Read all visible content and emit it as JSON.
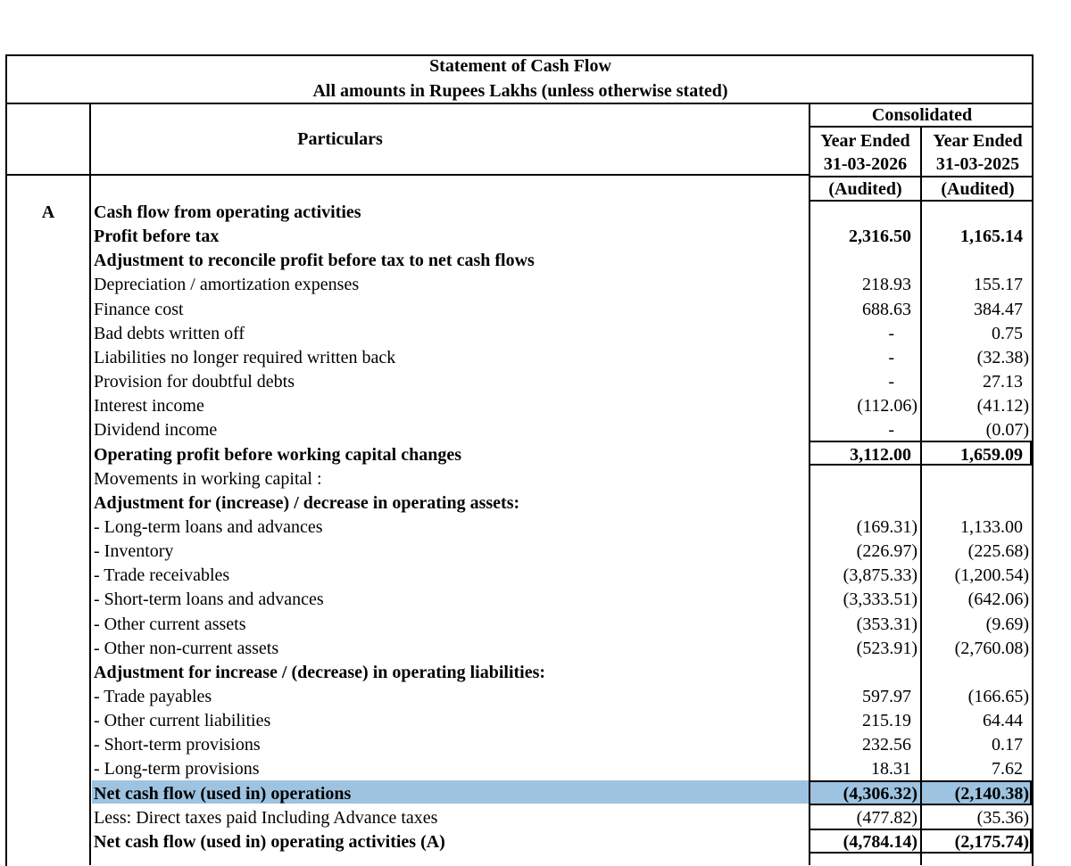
{
  "header": {
    "title": "Statement of Cash Flow",
    "subtitle": "All amounts in Rupees Lakhs (unless otherwise stated)",
    "particulars": "Particulars",
    "group": "Consolidated",
    "col1_line1": "Year Ended",
    "col1_line2": "31-03-2026",
    "col1_line3": "(Audited)",
    "col2_line1": "Year Ended",
    "col2_line2": "31-03-2025",
    "col2_line3": "(Audited)"
  },
  "section": {
    "label": "A"
  },
  "rows": [
    {
      "label": "Cash flow from operating activities",
      "v1": "",
      "v2": ""
    },
    {
      "label": "Profit before tax",
      "v1": "2,316.50",
      "v2": "1,165.14"
    },
    {
      "label": "Adjustment to reconcile profit before tax to net cash flows",
      "v1": "",
      "v2": ""
    },
    {
      "label": "Depreciation / amortization expenses",
      "v1": "218.93",
      "v2": "155.17"
    },
    {
      "label": "Finance cost",
      "v1": "688.63",
      "v2": "384.47"
    },
    {
      "label": "Bad debts written off",
      "v1": "-",
      "v2": "0.75"
    },
    {
      "label": "Liabilities no longer required written back",
      "v1": "-",
      "v2": "(32.38)"
    },
    {
      "label": "Provision for doubtful debts",
      "v1": "-",
      "v2": "27.13"
    },
    {
      "label": "Interest income",
      "v1": "(112.06)",
      "v2": "(41.12)"
    },
    {
      "label": "Dividend income",
      "v1": "-",
      "v2": "(0.07)"
    },
    {
      "label": "Operating profit before working capital changes",
      "v1": "3,112.00",
      "v2": "1,659.09"
    },
    {
      "label": "Movements in working capital :",
      "v1": "",
      "v2": ""
    },
    {
      "label": "Adjustment for (increase) / decrease in operating assets:",
      "v1": "",
      "v2": ""
    },
    {
      "label": "- Long-term loans and advances",
      "v1": "(169.31)",
      "v2": "1,133.00"
    },
    {
      "label": "- Inventory",
      "v1": "(226.97)",
      "v2": "(225.68)"
    },
    {
      "label": "- Trade receivables",
      "v1": "(3,875.33)",
      "v2": "(1,200.54)"
    },
    {
      "label": "- Short-term loans and advances",
      "v1": "(3,333.51)",
      "v2": "(642.06)"
    },
    {
      "label": "- Other current assets",
      "v1": "(353.31)",
      "v2": "(9.69)"
    },
    {
      "label": "- Other non-current assets",
      "v1": "(523.91)",
      "v2": "(2,760.08)"
    },
    {
      "label": "Adjustment for increase / (decrease) in operating liabilities:",
      "v1": "",
      "v2": ""
    },
    {
      "label": "- Trade payables",
      "v1": "597.97",
      "v2": "(166.65)"
    },
    {
      "label": "- Other current liabilities",
      "v1": "215.19",
      "v2": "64.44"
    },
    {
      "label": "- Short-term provisions",
      "v1": "232.56",
      "v2": "0.17"
    },
    {
      "label": "- Long-term provisions",
      "v1": "18.31",
      "v2": "7.62"
    },
    {
      "label": "Net cash flow (used in) operations",
      "v1": "(4,306.32)",
      "v2": "(2,140.38)"
    },
    {
      "label": "Less: Direct taxes paid Including Advance taxes",
      "v1": "(477.82)",
      "v2": "(35.36)"
    },
    {
      "label": "Net cash flow (used in) operating activities (A)",
      "v1": "(4,784.14)",
      "v2": "(2,175.74)"
    }
  ]
}
